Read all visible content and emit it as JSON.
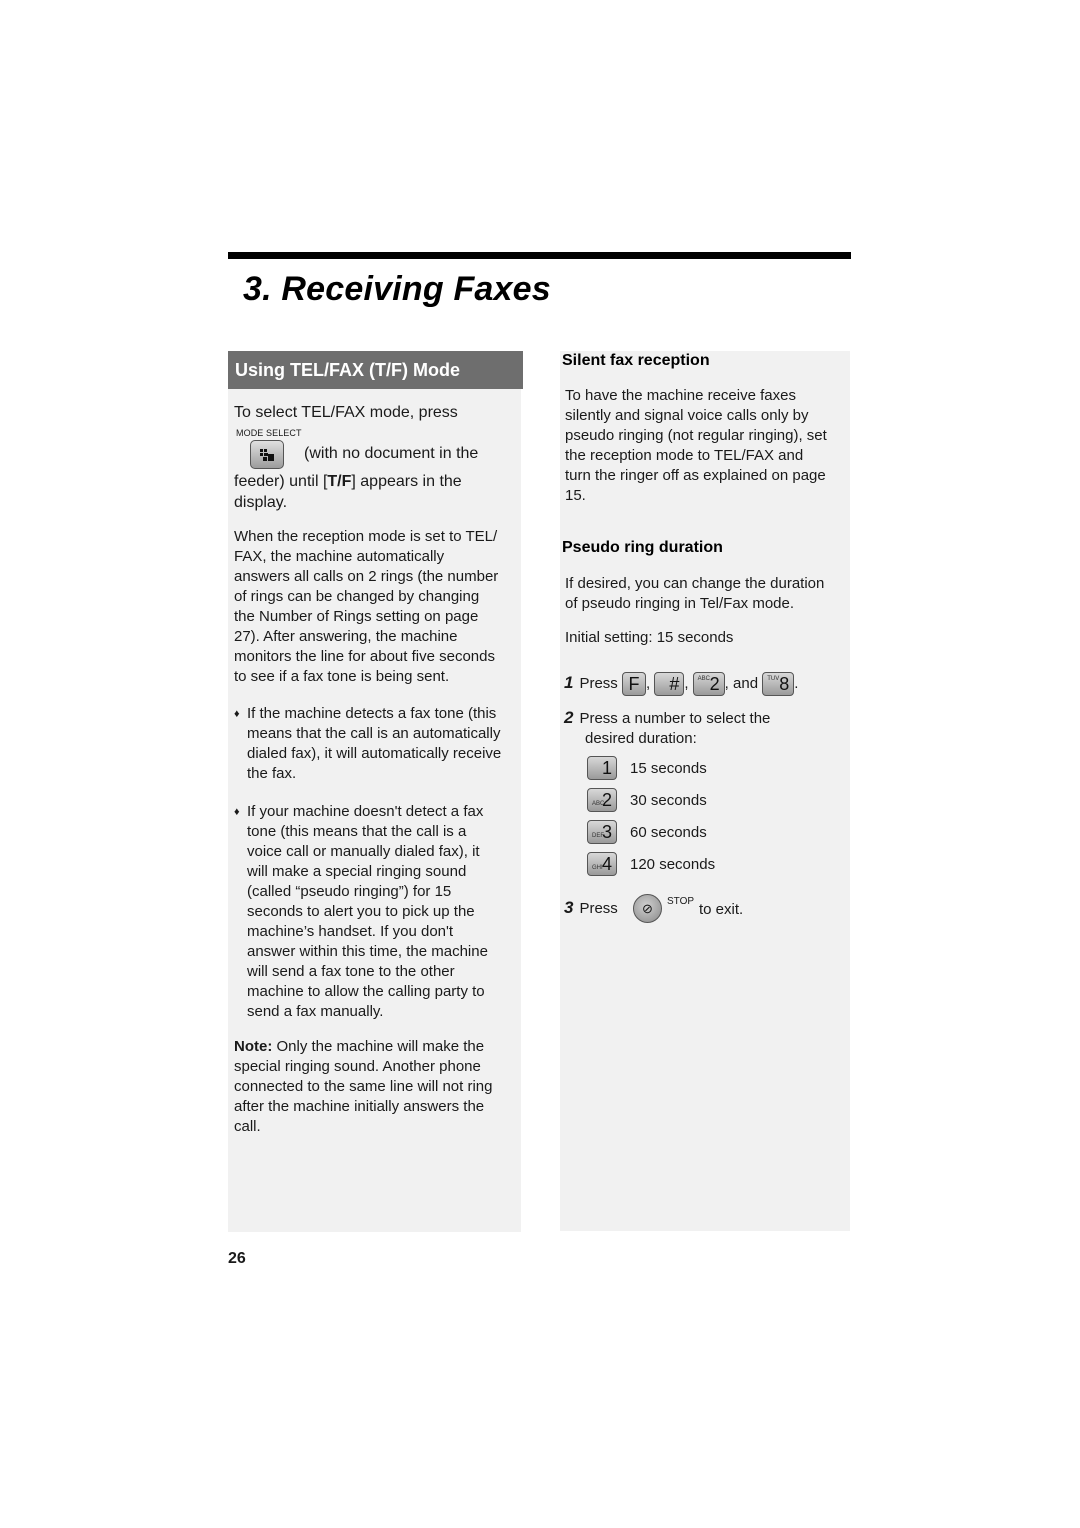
{
  "chapter": {
    "title": "3.  Receiving Faxes"
  },
  "left": {
    "section_title": "Using TEL/FAX (T/F) Mode",
    "intro_line1": "To select TEL/FAX mode, press",
    "mode_select_label": "MODE SELECT",
    "mode_select_icon": "mode-select-key",
    "intro_line2": "(with no document in the",
    "intro_line3_pre": "feeder) until [",
    "intro_line3_bold": "T/F",
    "intro_line3_post": "] appears in the",
    "intro_line4": "display.",
    "para1": [
      "When the reception mode is set to TEL/",
      "FAX, the machine automatically",
      "answers all calls on 2 rings (the number",
      "of rings can be changed by changing",
      "the Number of Rings setting on page",
      "27). After answering, the machine",
      "monitors the line for about five seconds",
      "to see if a fax tone is being sent."
    ],
    "bullet_mark": "♦",
    "bullet1": [
      "If the machine detects a fax tone (this",
      "means that the call is an automatically",
      "dialed fax), it will automatically receive",
      "the fax."
    ],
    "bullet2": [
      "If your machine doesn't detect a fax",
      "tone (this means that the call is a",
      "voice call or manually dialed fax), it",
      "will make a special ringing sound",
      "(called “pseudo ringing”) for 15",
      "seconds to alert you to pick up the",
      "machine’s handset. If you don't",
      "answer within this time, the machine",
      "will send a fax tone to the other",
      "machine to allow the calling party to",
      "send a fax manually."
    ],
    "note_label": "Note:",
    "note": [
      " Only the machine will make the",
      "special ringing sound. Another phone",
      "connected to the same line will not ring",
      "after the machine initially answers the",
      "call."
    ]
  },
  "right": {
    "silent_title": "Silent fax reception",
    "silent_text": [
      "To have the machine receive faxes",
      "silently and signal voice calls only by",
      "pseudo ringing (not regular ringing), set",
      "the reception mode to TEL/FAX and",
      "turn the ringer off as explained on page",
      "15."
    ],
    "pseudo_title": "Pseudo ring duration",
    "pseudo_text": [
      "If desired, you can change the duration",
      "of pseudo ringing in Tel/Fax mode."
    ],
    "initial_setting": "Initial setting: 15 seconds",
    "step1": {
      "num": "1",
      "press": "Press",
      "keys": [
        {
          "main": "F",
          "sub": ""
        },
        {
          "main": "#",
          "sub": ""
        },
        {
          "main": "2",
          "sub": "ABC"
        },
        {
          "main": "8",
          "sub": "TUV"
        }
      ],
      "sep1": ",",
      "sep2": ",",
      "sep3": ", and",
      "end": "."
    },
    "step2": {
      "num": "2",
      "text1": "Press a number to select the",
      "text2": "desired duration:"
    },
    "options": [
      {
        "key": "1",
        "sub": "",
        "label": "15 seconds"
      },
      {
        "key": "2",
        "sub": "ABC",
        "label": "30 seconds"
      },
      {
        "key": "3",
        "sub": "DEF",
        "label": "60 seconds"
      },
      {
        "key": "4",
        "sub": "GHI",
        "label": "120 seconds"
      }
    ],
    "step3": {
      "num": "3",
      "press": "Press",
      "stop_label": "STOP",
      "stop_glyph": "⊘",
      "end": "to exit."
    }
  },
  "page_number": "26"
}
